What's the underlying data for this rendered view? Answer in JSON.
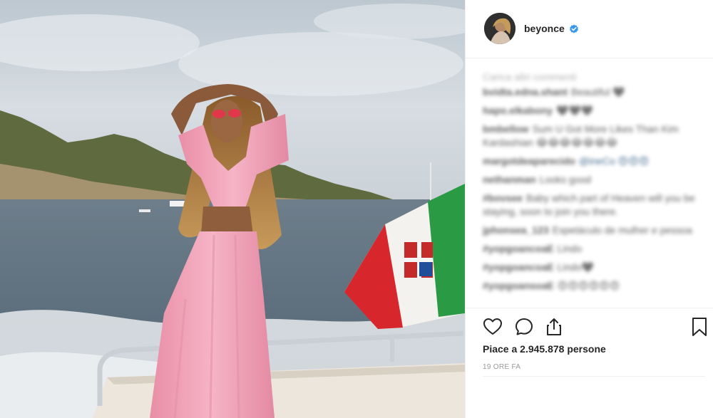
{
  "post": {
    "username": "beyonce",
    "verified_icon": "verified-badge-icon",
    "avatar_icon": "avatar-image",
    "photo_description_icon": "post-photo",
    "load_more": "Carica altri commenti",
    "comments": [
      {
        "user": "bvidta.edna.shant",
        "text": "Beautiful 🖤"
      },
      {
        "user": "hapo.elkabony",
        "text": "🖤🖤🖤"
      },
      {
        "user": "bmbellow",
        "text": "Sum U Got More Likes Than Kim Kardashian 😂😂😂😂😂😂😂"
      },
      {
        "user": "margotdeaparecido",
        "text": "@ineCo 😍😍😍"
      },
      {
        "user": "nethanman",
        "text": "Looks good"
      },
      {
        "user": "#bovsee",
        "text": "Baby which part of Heaven will you be staying, soon to join you there."
      },
      {
        "user": "jphonsea_123",
        "text": "Espetáculo de mulher e pessoa"
      },
      {
        "user": "#yopgoancoaE",
        "text": "Lindo"
      },
      {
        "user": "#yopgoancoaE",
        "text": "Lindo🖤"
      },
      {
        "user": "#yopgoansoaE",
        "text": "😍😍😍😍😍😍"
      }
    ],
    "likes_text": "Piace a 2.945.878 persone",
    "timestamp": "19 ORE FA",
    "icons": {
      "like": "heart-icon",
      "comment": "comment-icon",
      "share": "share-icon",
      "save": "bookmark-icon"
    },
    "colors": {
      "verified": "#3897f0",
      "text": "#262626",
      "muted": "#999999",
      "border": "#efefef",
      "dress": "#f3a7bc",
      "flag_green": "#2b9a45",
      "flag_red": "#d8262d"
    }
  }
}
